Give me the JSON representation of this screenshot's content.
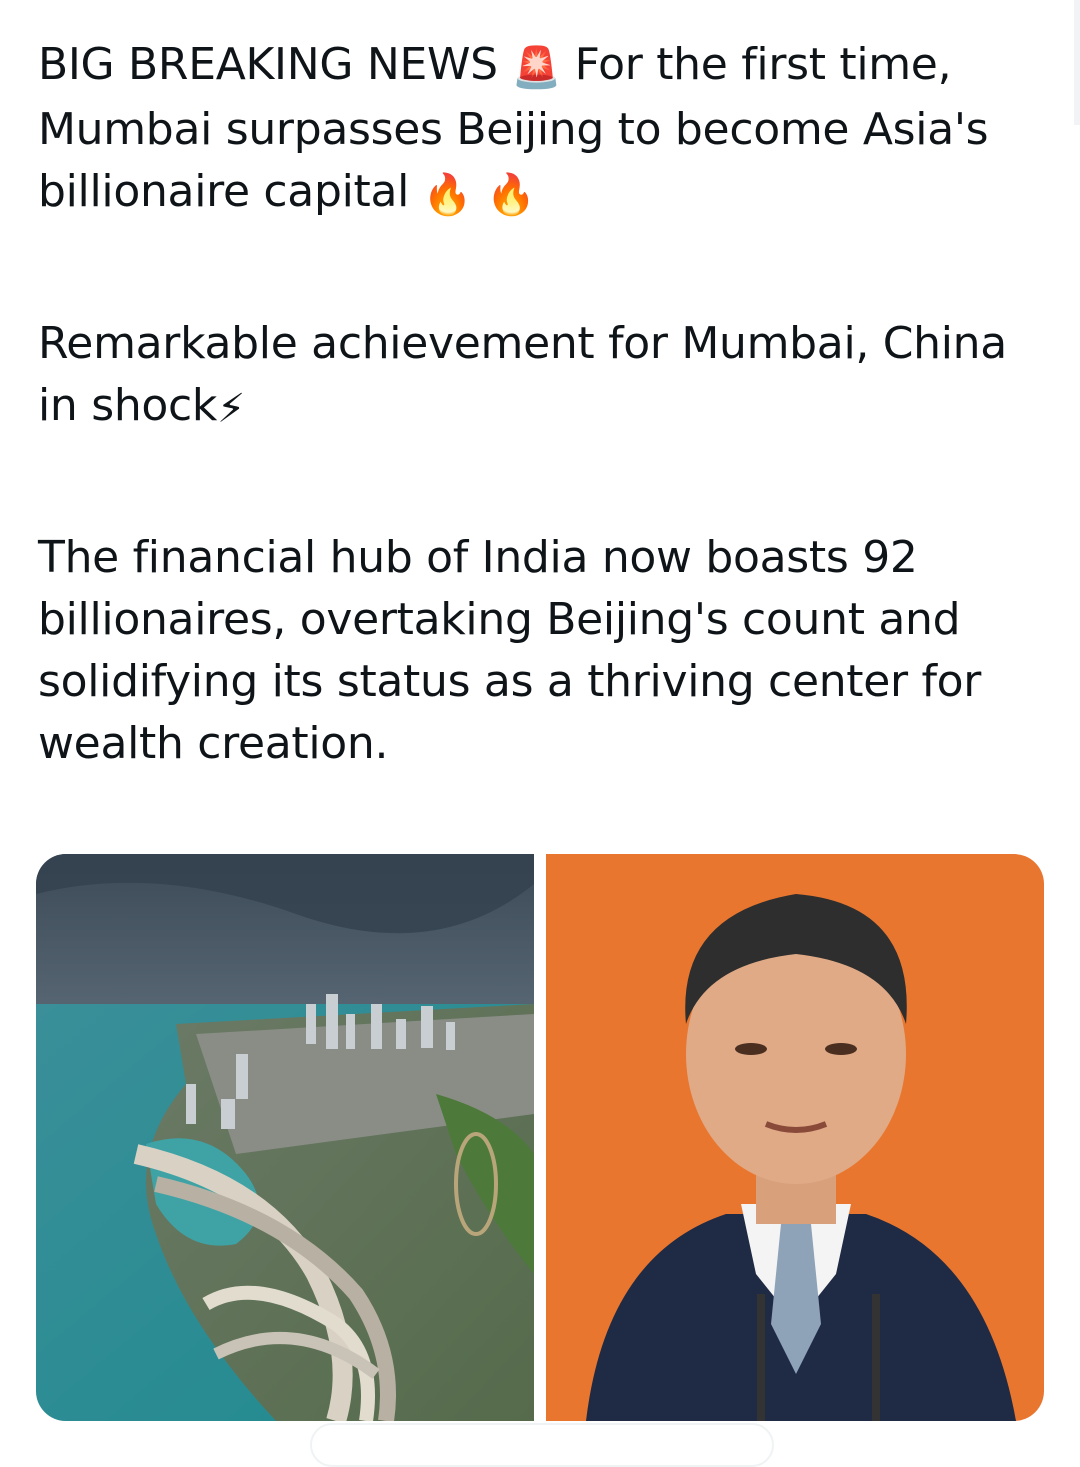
{
  "tweet": {
    "paragraphs": [
      {
        "before": "BIG BREAKING NEWS ",
        "emoji1": "🚨",
        "middle": " For the first time, Mumbai surpasses Beijing to become Asia's billionaire capital ",
        "emoji2": "🔥",
        "emoji3": "🔥"
      },
      {
        "text": "Remarkable achievement for Mumbai, China in shock",
        "emoji": "⚡"
      },
      {
        "text": "The financial hub of India now boasts 92 billionaires, overtaking Beijing's count and solidifying its status as a thriving center for wealth creation."
      }
    ]
  },
  "media": {
    "left_icon": "city-coastline-aerial-photo",
    "right_icon": "leader-portrait-photo",
    "colors": {
      "sea": "#2b9aa0",
      "sky": "#4c5d6d",
      "orange_bg": "#e8762f",
      "suit": "#1f2a44"
    }
  }
}
